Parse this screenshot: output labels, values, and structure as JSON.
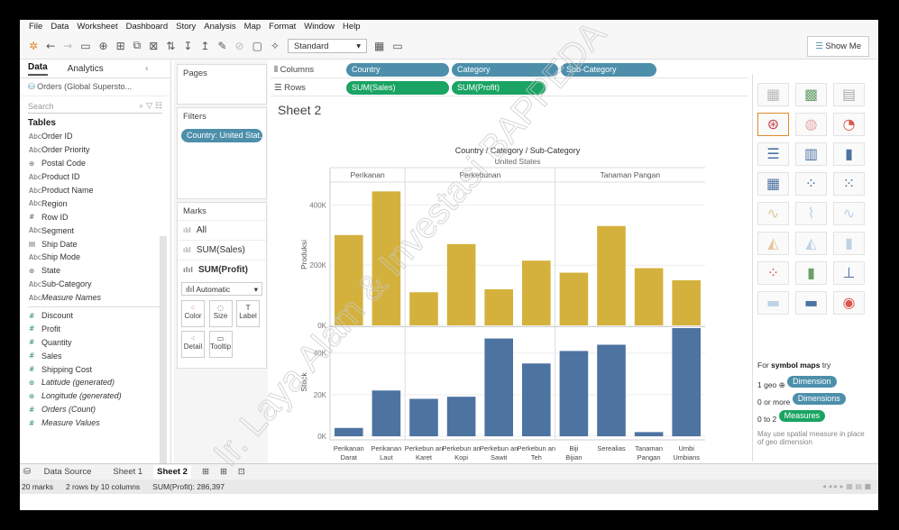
{
  "menu": [
    "File",
    "Data",
    "Worksheet",
    "Dashboard",
    "Story",
    "Analysis",
    "Map",
    "Format",
    "Window",
    "Help"
  ],
  "toolbar": {
    "fit_select": "Standard",
    "show_me": "Show Me"
  },
  "data_pane": {
    "tabs": [
      "Data",
      "Analytics"
    ],
    "source": "Orders (Global Supersto...",
    "search_placeholder": "Search",
    "tables_label": "Tables",
    "dimensions": [
      {
        "type": "Abc",
        "name": "Order ID"
      },
      {
        "type": "Abc",
        "name": "Order Priority"
      },
      {
        "type": "globe",
        "name": "Postal Code"
      },
      {
        "type": "Abc",
        "name": "Product ID"
      },
      {
        "type": "Abc",
        "name": "Product Name"
      },
      {
        "type": "Abc",
        "name": "Region"
      },
      {
        "type": "#",
        "name": "Row ID"
      },
      {
        "type": "Abc",
        "name": "Segment"
      },
      {
        "type": "date",
        "name": "Ship Date"
      },
      {
        "type": "Abc",
        "name": "Ship Mode"
      },
      {
        "type": "globe",
        "name": "State"
      },
      {
        "type": "Abc",
        "name": "Sub-Category"
      },
      {
        "type": "Abc",
        "name": "Measure Names",
        "italic": true
      }
    ],
    "measures": [
      {
        "type": "#",
        "name": "Discount"
      },
      {
        "type": "#",
        "name": "Profit"
      },
      {
        "type": "#",
        "name": "Quantity"
      },
      {
        "type": "#",
        "name": "Sales"
      },
      {
        "type": "#",
        "name": "Shipping Cost"
      },
      {
        "type": "globe",
        "name": "Latitude (generated)",
        "italic": true
      },
      {
        "type": "globe",
        "name": "Longitude (generated)",
        "italic": true
      },
      {
        "type": "#",
        "name": "Orders (Count)",
        "italic": true
      },
      {
        "type": "#",
        "name": "Measure Values",
        "italic": true
      }
    ]
  },
  "cards": {
    "pages": "Pages",
    "filters": "Filters",
    "filter_pill": "Country: United Stat..",
    "marks": "Marks",
    "marks_rows": [
      "All",
      "SUM(Sales)",
      "SUM(Profit)"
    ],
    "mark_type": "Automatic",
    "mark_buttons": [
      "Color",
      "Size",
      "Label",
      "Detail",
      "Tooltip"
    ]
  },
  "shelves": {
    "columns_label": "Columns",
    "rows_label": "Rows",
    "columns": [
      "Country",
      "Category",
      "Sub-Category"
    ],
    "rows": [
      "SUM(Sales)",
      "SUM(Profit)"
    ]
  },
  "sheet_title": "Sheet 2",
  "chart_data": {
    "type": "bar",
    "header": "Country / Category / Sub-Category",
    "country": "United States",
    "categories_top": [
      "Perikanan",
      "Perkebunan",
      "Tanaman Pangan"
    ],
    "subcategories": [
      "Perikanan Darat",
      "Perikanan Laut",
      "Perkebun an Karet",
      "Perkebun an Kopi",
      "Perkebun an Sawit",
      "Perkebun an Teh",
      "Biji Bijian",
      "Serealias",
      "Tanaman Pangan",
      "Umbi Umbians"
    ],
    "group_sizes": [
      2,
      4,
      4
    ],
    "series": [
      {
        "name": "Produksi",
        "color": "#d4b13c",
        "ylim": [
          0,
          470000
        ],
        "ticks": [
          {
            "v": 0,
            "label": "0K"
          },
          {
            "v": 200000,
            "label": "200K"
          },
          {
            "v": 400000,
            "label": "400K"
          }
        ],
        "values": [
          300000,
          445000,
          110000,
          270000,
          120000,
          215000,
          175000,
          330000,
          190000,
          150000
        ]
      },
      {
        "name": "Stock",
        "color": "#4d73a1",
        "ylim": [
          0,
          52000
        ],
        "ticks": [
          {
            "v": 0,
            "label": "0K"
          },
          {
            "v": 20000,
            "label": "20K"
          },
          {
            "v": 40000,
            "label": "40K"
          }
        ],
        "values": [
          4000,
          22000,
          18000,
          19000,
          47000,
          35000,
          41000,
          44000,
          2000,
          55000
        ]
      }
    ]
  },
  "show_me": {
    "hint_prefix": "For ",
    "hint_bold": "symbol maps",
    "hint_suffix": " try",
    "req1_prefix": "1 geo",
    "req1_pill": "Dimension",
    "req2_prefix": "0 or more",
    "req2_pill": "Dimensions",
    "req3_prefix": "0 to 2",
    "req3_pill": "Measures",
    "note": "May use spatial measure in place of geo dimension"
  },
  "tabs": [
    "Data Source",
    "Sheet 1",
    "Sheet 2"
  ],
  "status": {
    "marks": "20 marks",
    "dims": "2 rows by 10 columns",
    "sum": "SUM(Profit): 286,397"
  },
  "watermark": "Ir. Laya Alam & Investasi BAPPEDA"
}
